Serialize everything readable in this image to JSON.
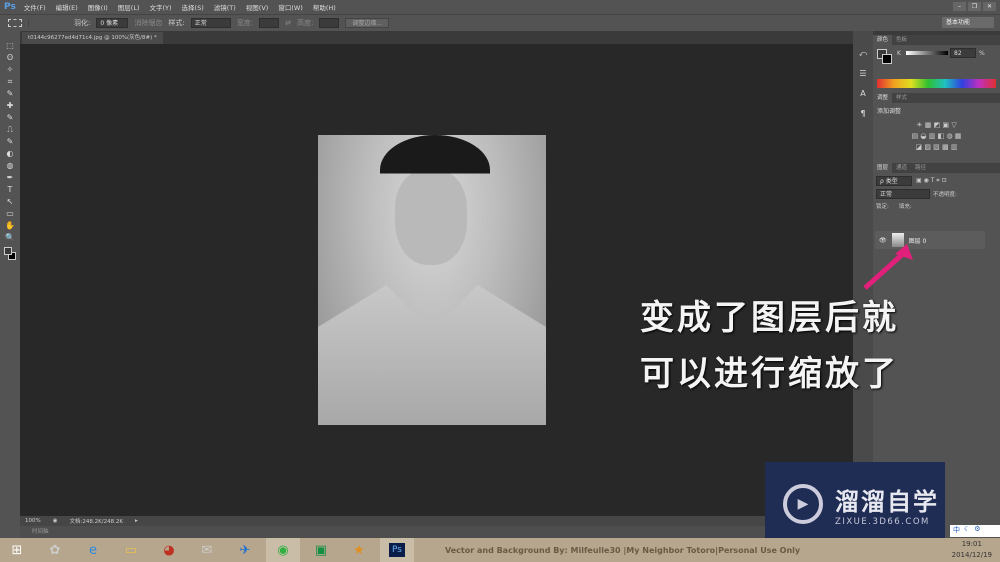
{
  "app": {
    "logo": "Ps",
    "menu": [
      "文件(F)",
      "编辑(E)",
      "图像(I)",
      "图层(L)",
      "文字(Y)",
      "选择(S)",
      "滤镜(T)",
      "视图(V)",
      "窗口(W)",
      "帮助(H)"
    ],
    "window_buttons": [
      "–",
      "❐",
      "✕"
    ]
  },
  "options": {
    "feather_label": "羽化:",
    "feather_value": "0 像素",
    "antialias": "消除锯齿",
    "style_label": "样式:",
    "style_value": "正常",
    "width_label": "宽度:",
    "height_label": "高度:",
    "refine_edge": "调整边缘...",
    "workspace": "基本功能"
  },
  "document": {
    "tab": "t0144c96277ed4d71c4.jpg @ 100%(灰色/8#) *",
    "zoom": "100%",
    "doc_size": "文档:248.2K/248.2K",
    "timeline": "时间轴"
  },
  "tools": [
    "⬚",
    "⬚",
    "ʘ",
    "✧",
    "⌗",
    "✎",
    "✚",
    "✎",
    "⎍",
    "✎",
    "◐",
    "◍",
    "✒",
    "T",
    "↖",
    "▭",
    "✋",
    "🔍"
  ],
  "panels": {
    "color": {
      "tabs": [
        "颜色",
        "色板"
      ],
      "channel": "K",
      "value": "82",
      "unit": "%"
    },
    "adjust": {
      "tabs": [
        "调整",
        "样式"
      ],
      "title": "添加调整"
    },
    "layers": {
      "tabs": [
        "图层",
        "通道",
        "路径"
      ],
      "filter": "ρ 类型",
      "blend": "正常",
      "opacity_label": "不透明度:",
      "lock_label": "锁定:",
      "fill_label": "填充:",
      "layer_name": "图层 0"
    }
  },
  "caption": {
    "line1": "变成了图层后就",
    "line2": "可以进行缩放了"
  },
  "watermark": {
    "title": "溜溜自学",
    "url": "ZIXUE.3D66.COM"
  },
  "taskbar": {
    "text": "Vector and Background By: Milfeulle30 |My Neighbor Totoro|Personal Use Only",
    "time": "19:01",
    "date": "2014/12/19",
    "ime": "中"
  },
  "colors": {
    "accent_arrow": "#e0207a",
    "watermark_bg": "#1f2d55"
  }
}
